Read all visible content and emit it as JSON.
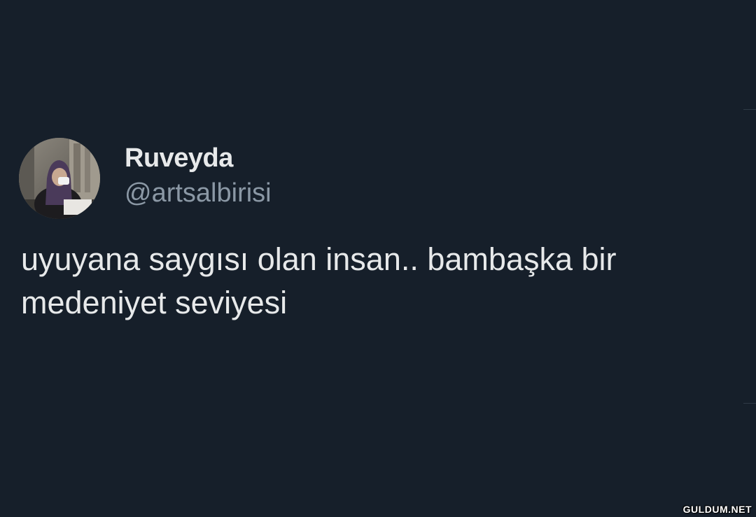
{
  "tweet": {
    "author": {
      "display_name": "Ruveyda",
      "handle": "@artsalbirisi",
      "avatar_icon": "profile-photo"
    },
    "text_lines": [
      "uyuyana saygısı olan insan.. bambaşka bir",
      "medeniyet seviyesi"
    ]
  },
  "watermark": "GULDUM.NET",
  "colors": {
    "background": "#161f2a",
    "primary_text": "#e7e9ea",
    "secondary_text": "#8b98a5"
  }
}
